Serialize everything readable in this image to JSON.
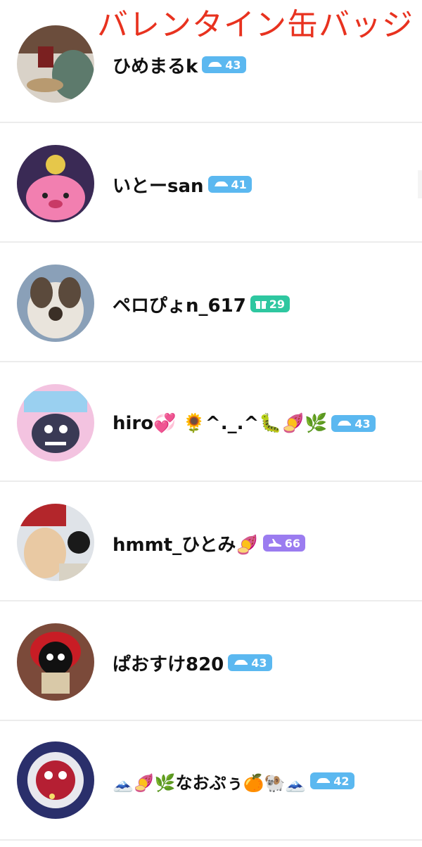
{
  "overlay_title": "バレンタイン缶バッジ",
  "users": [
    {
      "name": "ひめまるk",
      "badge_icon": "car-icon",
      "badge_value": "43",
      "badge_color": "#5bb8f0"
    },
    {
      "name": "いとーsan",
      "badge_icon": "car-icon",
      "badge_value": "41",
      "badge_color": "#5bb8f0"
    },
    {
      "name": "ペロぴょn_617",
      "badge_icon": "gift-icon",
      "badge_value": "29",
      "badge_color": "#2ec7a0"
    },
    {
      "name": "hiro💞 🌻^._.^🐛🍠🌿",
      "badge_icon": "car-icon",
      "badge_value": "43",
      "badge_color": "#5bb8f0"
    },
    {
      "name": "hmmt_ひとみ🍠",
      "badge_icon": "plane-icon",
      "badge_value": "66",
      "badge_color": "#9b7cf0"
    },
    {
      "name": "ぱおすけ820",
      "badge_icon": "car-icon",
      "badge_value": "43",
      "badge_color": "#5bb8f0"
    },
    {
      "name": "🗻🍠🌿なおぷぅ🍊🐏🗻",
      "badge_icon": "car-icon",
      "badge_value": "42",
      "badge_color": "#5bb8f0"
    }
  ]
}
